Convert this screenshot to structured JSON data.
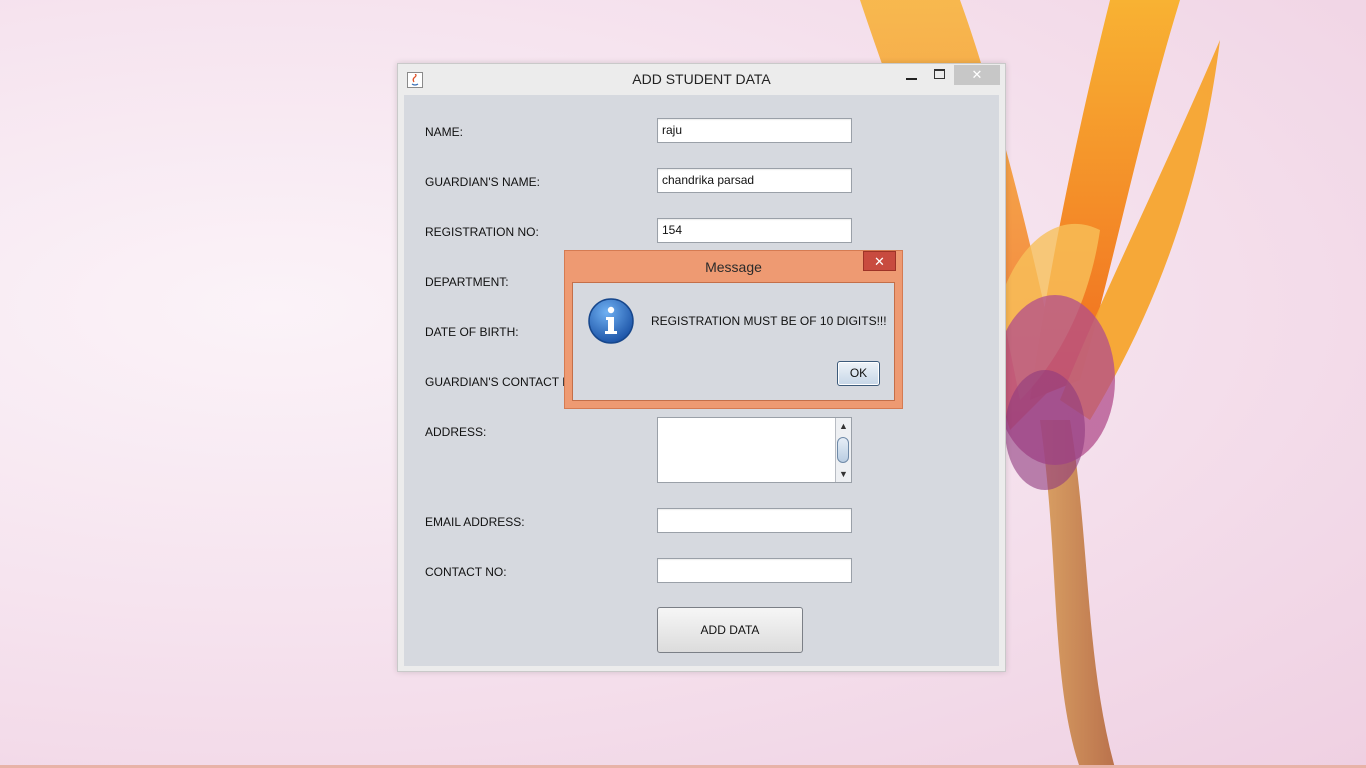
{
  "window": {
    "title": "ADD STUDENT DATA",
    "close_glyph": "✕"
  },
  "form": {
    "fields": [
      {
        "label": "NAME:",
        "value": "raju"
      },
      {
        "label": "GUARDIAN'S NAME:",
        "value": "chandrika parsad"
      },
      {
        "label": "REGISTRATION NO:",
        "value": "154"
      },
      {
        "label": "DEPARTMENT:",
        "value": ""
      },
      {
        "label": "DATE OF BIRTH:",
        "value": ""
      },
      {
        "label": "GUARDIAN'S CONTACT N",
        "value": ""
      },
      {
        "label": "ADDRESS:",
        "value": ""
      },
      {
        "label": "EMAIL ADDRESS:",
        "value": ""
      },
      {
        "label": "CONTACT NO:",
        "value": ""
      }
    ],
    "add_button": "ADD DATA"
  },
  "dialog": {
    "title": "Message",
    "message": "REGISTRATION MUST BE OF 10 DIGITS!!!",
    "ok_button": "OK",
    "close_glyph": "✕",
    "icon": "info-icon"
  },
  "colors": {
    "dialog_border": "#ee9a72",
    "dialog_close": "#c84b3f",
    "form_background": "#d6d9df",
    "info_icon": "#2f6fc0"
  }
}
